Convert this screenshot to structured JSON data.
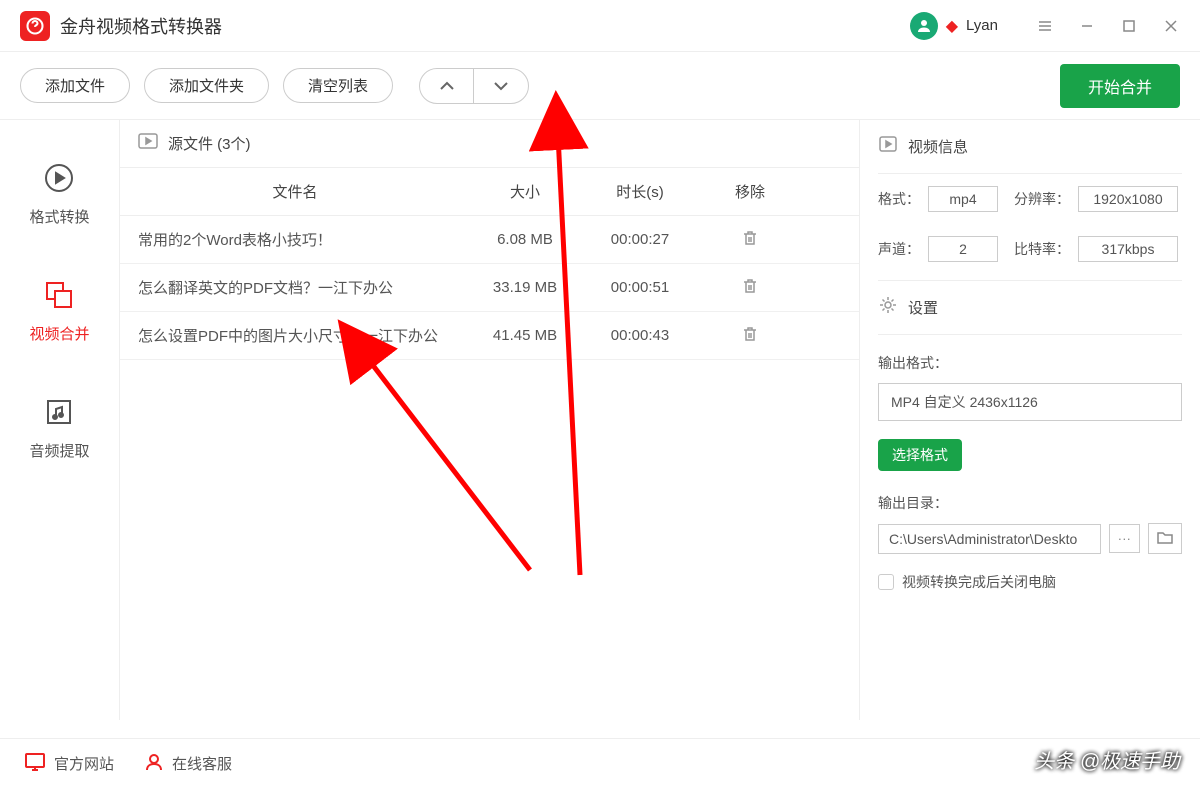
{
  "app": {
    "title": "金舟视频格式转换器"
  },
  "user": {
    "name": "Lyan"
  },
  "toolbar": {
    "add_file": "添加文件",
    "add_folder": "添加文件夹",
    "clear_list": "清空列表",
    "start_merge": "开始合并"
  },
  "sidebar": {
    "items": [
      {
        "label": "格式转换"
      },
      {
        "label": "视频合并"
      },
      {
        "label": "音频提取"
      }
    ]
  },
  "filelist": {
    "header": "源文件 (3个)",
    "columns": {
      "name": "文件名",
      "size": "大小",
      "duration": "时长(s)",
      "delete": "移除"
    },
    "rows": [
      {
        "name": "常用的2个Word表格小技巧！",
        "size": "6.08 MB",
        "duration": "00:00:27"
      },
      {
        "name": "怎么翻译英文的PDF文档？一江下办公",
        "size": "33.19 MB",
        "duration": "00:00:51"
      },
      {
        "name": "怎么设置PDF中的图片大小尺寸？一江下办公",
        "size": "41.45 MB",
        "duration": "00:00:43"
      }
    ]
  },
  "videoinfo": {
    "title": "视频信息",
    "format_label": "格式：",
    "format": "mp4",
    "res_label": "分辨率：",
    "res": "1920x1080",
    "channel_label": "声道：",
    "channel": "2",
    "bitrate_label": "比特率：",
    "bitrate": "317kbps"
  },
  "settings": {
    "title": "设置",
    "output_format_label": "输出格式：",
    "output_format": "MP4 自定义 2436x1126",
    "choose_format": "选择格式",
    "output_dir_label": "输出目录：",
    "output_dir": "C:\\Users\\Administrator\\Deskto",
    "shutdown_label": "视频转换完成后关闭电脑"
  },
  "footer": {
    "website": "官方网站",
    "service": "在线客服"
  },
  "watermark": "头条 @极速手助"
}
